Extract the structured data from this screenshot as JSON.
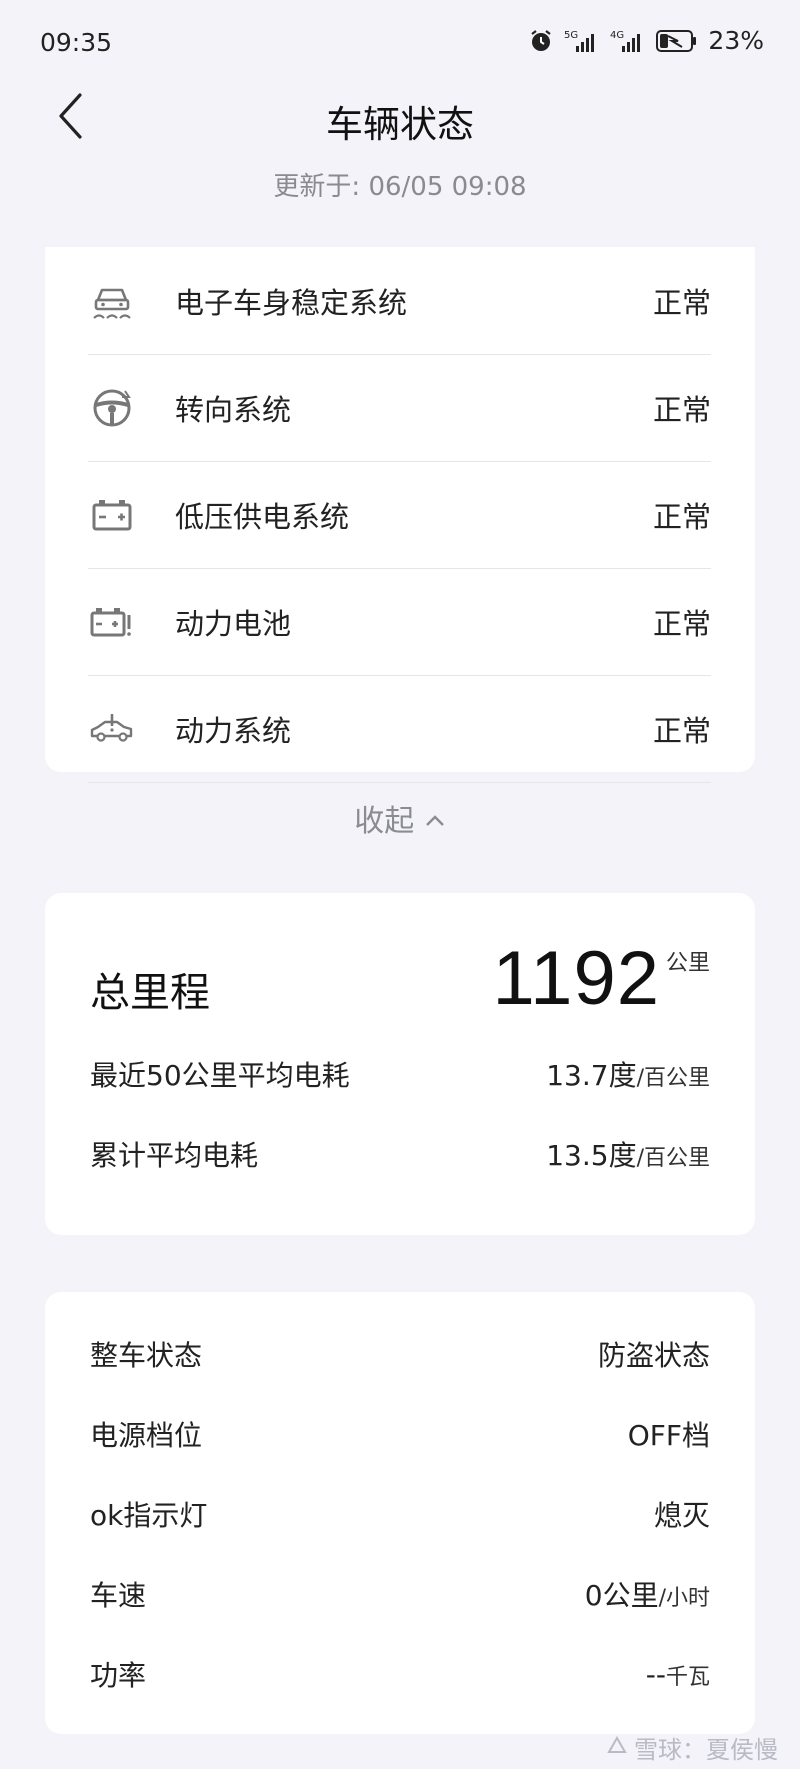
{
  "status_bar": {
    "time": "09:35",
    "signal1": "5G",
    "signal2": "4G",
    "battery_pct": "23%"
  },
  "header": {
    "title": "车辆状态",
    "updated": "更新于: 06/05 09:08",
    "back_icon": "chevron-left-icon"
  },
  "systems": {
    "items": [
      {
        "icon": "stability-car-icon",
        "label": "电子车身稳定系统",
        "status": "正常"
      },
      {
        "icon": "steering-wheel-icon",
        "label": "转向系统",
        "status": "正常"
      },
      {
        "icon": "battery-12v-icon",
        "label": "低压供电系统",
        "status": "正常"
      },
      {
        "icon": "battery-warning-icon",
        "label": "动力电池",
        "status": "正常"
      },
      {
        "icon": "car-power-icon",
        "label": "动力系统",
        "status": "正常"
      }
    ],
    "collapse_label": "收起"
  },
  "mileage": {
    "title": "总里程",
    "value": "1192",
    "unit": "公里",
    "rows": [
      {
        "label": "最近50公里平均电耗",
        "value": "13.7度",
        "unit": "/百公里"
      },
      {
        "label": "累计平均电耗",
        "value": "13.5度",
        "unit": "/百公里"
      }
    ]
  },
  "vehicle_status": {
    "rows": [
      {
        "label": "整车状态",
        "value": "防盗状态",
        "unit": ""
      },
      {
        "label": "电源档位",
        "value": "OFF档",
        "unit": ""
      },
      {
        "label": "ok指示灯",
        "value": "熄灭",
        "unit": ""
      },
      {
        "label": "车速",
        "value": "0公里",
        "unit": "/小时"
      },
      {
        "label": "功率",
        "value": "--",
        "unit": "千瓦"
      }
    ]
  },
  "watermark": {
    "text": "雪球：夏侯慢"
  }
}
